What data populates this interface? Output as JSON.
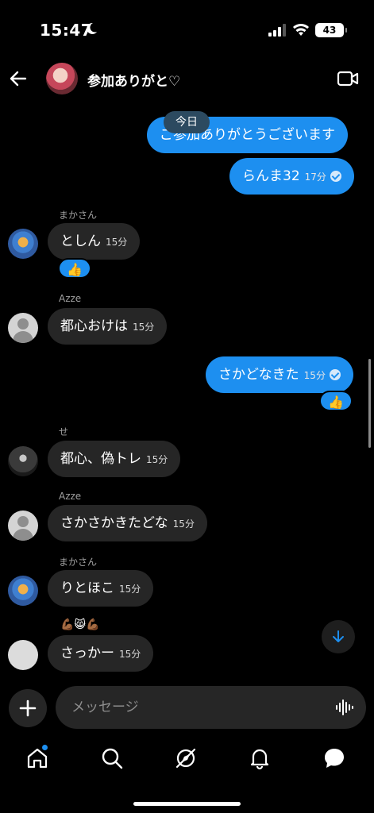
{
  "status": {
    "time": "15:47",
    "battery": "43"
  },
  "header": {
    "title": "参加ありがと♡"
  },
  "date_chip": "今日",
  "messages": [
    {
      "dir": "out",
      "text": "ご参加ありがとうございます",
      "time": ""
    },
    {
      "dir": "out",
      "text": "らんま32",
      "time": "17分"
    },
    {
      "dir": "in",
      "sender": "まかさん",
      "text": "としん",
      "time": "15分",
      "reaction": "👍"
    },
    {
      "dir": "in",
      "sender": "Azze",
      "text": "都心おけは",
      "time": "15分"
    },
    {
      "dir": "out",
      "text": "さかどなきた",
      "time": "15分",
      "reaction": "👍"
    },
    {
      "dir": "in",
      "sender": "せ",
      "text": "都心、偽トレ",
      "time": "15分"
    },
    {
      "dir": "in",
      "sender": "Azze",
      "text": "さかさかきたどな",
      "time": "15分"
    },
    {
      "dir": "in",
      "sender": "まかさん",
      "text": "りとほこ",
      "time": "15分"
    },
    {
      "dir": "in",
      "sender": "💪🏾😸💪🏾",
      "text": "さっかー",
      "time": "15分"
    }
  ],
  "composer": {
    "placeholder": "メッセージ"
  },
  "icons": {
    "back": "arrow-left-icon",
    "video": "video-camera-icon",
    "plus": "plus-icon",
    "mic": "voice-wave-icon",
    "home": "home-icon",
    "search": "search-icon",
    "explore": "compass-icon",
    "notifications": "bell-icon",
    "messages": "chat-bubble-icon"
  },
  "colors": {
    "accent": "#1d8ff0",
    "incoming": "#262626",
    "background": "#000000"
  }
}
